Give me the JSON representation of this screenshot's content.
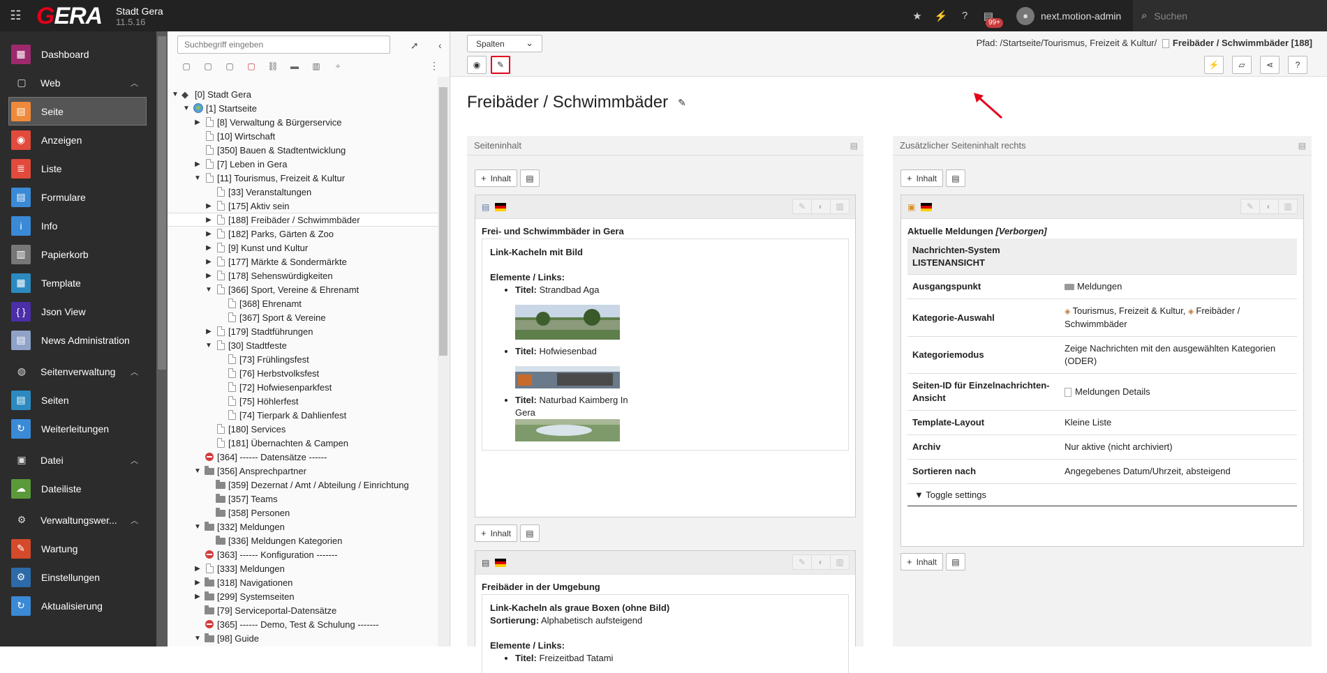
{
  "topbar": {
    "site_name": "Stadt Gera",
    "version": "11.5.16",
    "logo_text_a": "G",
    "logo_text_b": "ERA",
    "notifications_badge": "99+",
    "username": "next.motion-admin",
    "search_placeholder": "Suchen"
  },
  "sidebar": {
    "items": [
      {
        "type": "item",
        "label": "Dashboard",
        "icon": "dashboard-icon",
        "color": "#9e2a6d",
        "glyph": "▦"
      },
      {
        "type": "group",
        "label": "Web",
        "icon": "web-icon",
        "glyph": "▢"
      },
      {
        "type": "item",
        "label": "Seite",
        "icon": "page-module-icon",
        "color": "#f08a3a",
        "glyph": "▤",
        "active": true
      },
      {
        "type": "item",
        "label": "Anzeigen",
        "icon": "view-icon",
        "color": "#e24a3b",
        "glyph": "◉"
      },
      {
        "type": "item",
        "label": "Liste",
        "icon": "list-icon",
        "color": "#e24a3b",
        "glyph": "≣"
      },
      {
        "type": "item",
        "label": "Formulare",
        "icon": "forms-icon",
        "color": "#3a8ad6",
        "glyph": "▤"
      },
      {
        "type": "item",
        "label": "Info",
        "icon": "info-icon",
        "color": "#3a8ad6",
        "glyph": "i"
      },
      {
        "type": "item",
        "label": "Papierkorb",
        "icon": "trash-icon",
        "color": "#777",
        "glyph": "▥"
      },
      {
        "type": "item",
        "label": "Template",
        "icon": "template-icon",
        "color": "#2c8ac0",
        "glyph": "▦"
      },
      {
        "type": "item",
        "label": "Json View",
        "icon": "json-view-icon",
        "color": "#4b2ea8",
        "glyph": "{ }"
      },
      {
        "type": "item",
        "label": "News Administration",
        "icon": "news-icon",
        "color": "#8fa2c8",
        "glyph": "▤"
      },
      {
        "type": "group",
        "label": "Seitenverwaltung",
        "icon": "globe-icon",
        "glyph": "◍"
      },
      {
        "type": "item",
        "label": "Seiten",
        "icon": "pages-icon",
        "color": "#2c8ac0",
        "glyph": "▤"
      },
      {
        "type": "item",
        "label": "Weiterleitungen",
        "icon": "redirect-icon",
        "color": "#3a8ad6",
        "glyph": "↻"
      },
      {
        "type": "group",
        "label": "Datei",
        "icon": "file-icon",
        "glyph": "▣"
      },
      {
        "type": "item",
        "label": "Dateiliste",
        "icon": "filelist-icon",
        "color": "#5a9a3a",
        "glyph": "☁"
      },
      {
        "type": "group",
        "label": "Verwaltungswer...",
        "icon": "admin-tools-icon",
        "glyph": "⚙"
      },
      {
        "type": "item",
        "label": "Wartung",
        "icon": "maintenance-icon",
        "color": "#d44a2a",
        "glyph": "✎"
      },
      {
        "type": "item",
        "label": "Einstellungen",
        "icon": "settings-icon",
        "color": "#2c6aa8",
        "glyph": "⚙"
      },
      {
        "type": "item",
        "label": "Aktualisierung",
        "icon": "upgrade-icon",
        "color": "#3a8ad6",
        "glyph": "↻"
      }
    ]
  },
  "tree": {
    "search_placeholder": "Suchbegriff eingeben",
    "nodes": [
      {
        "label": "[0] Stadt Gera",
        "level": 0,
        "toggle": "open",
        "icon": "root"
      },
      {
        "label": "[1] Startseite",
        "level": 1,
        "toggle": "open",
        "icon": "globe"
      },
      {
        "label": "[8] Verwaltung & Bürgerservice",
        "level": 2,
        "toggle": "closed",
        "icon": "page"
      },
      {
        "label": "[10] Wirtschaft",
        "level": 2,
        "toggle": "",
        "icon": "page"
      },
      {
        "label": "[350] Bauen & Stadtentwicklung",
        "level": 2,
        "toggle": "",
        "icon": "page"
      },
      {
        "label": "[7] Leben in Gera",
        "level": 2,
        "toggle": "closed",
        "icon": "page"
      },
      {
        "label": "[11] Tourismus, Freizeit & Kultur",
        "level": 2,
        "toggle": "open",
        "icon": "page"
      },
      {
        "label": "[33] Veranstaltungen",
        "level": 3,
        "toggle": "",
        "icon": "page"
      },
      {
        "label": "[175] Aktiv sein",
        "level": 3,
        "toggle": "closed",
        "icon": "page"
      },
      {
        "label": "[188] Freibäder / Schwimmbäder",
        "level": 3,
        "toggle": "closed",
        "icon": "page",
        "selected": true
      },
      {
        "label": "[182] Parks, Gärten & Zoo",
        "level": 3,
        "toggle": "closed",
        "icon": "page"
      },
      {
        "label": "[9] Kunst und Kultur",
        "level": 3,
        "toggle": "closed",
        "icon": "page"
      },
      {
        "label": "[177] Märkte & Sondermärkte",
        "level": 3,
        "toggle": "closed",
        "icon": "page"
      },
      {
        "label": "[178] Sehenswürdigkeiten",
        "level": 3,
        "toggle": "closed",
        "icon": "page"
      },
      {
        "label": "[366] Sport, Vereine & Ehrenamt",
        "level": 3,
        "toggle": "open",
        "icon": "page"
      },
      {
        "label": "[368] Ehrenamt",
        "level": 4,
        "toggle": "",
        "icon": "page"
      },
      {
        "label": "[367] Sport & Vereine",
        "level": 4,
        "toggle": "",
        "icon": "page"
      },
      {
        "label": "[179] Stadtführungen",
        "level": 3,
        "toggle": "closed",
        "icon": "page"
      },
      {
        "label": "[30] Stadtfeste",
        "level": 3,
        "toggle": "open",
        "icon": "page"
      },
      {
        "label": "[73] Frühlingsfest",
        "level": 4,
        "toggle": "",
        "icon": "page"
      },
      {
        "label": "[76] Herbstvolksfest",
        "level": 4,
        "toggle": "",
        "icon": "page"
      },
      {
        "label": "[72] Hofwiesenparkfest",
        "level": 4,
        "toggle": "",
        "icon": "page"
      },
      {
        "label": "[75] Höhlerfest",
        "level": 4,
        "toggle": "",
        "icon": "page"
      },
      {
        "label": "[74] Tierpark & Dahlienfest",
        "level": 4,
        "toggle": "",
        "icon": "page"
      },
      {
        "label": "[180] Services",
        "level": 3,
        "toggle": "",
        "icon": "page"
      },
      {
        "label": "[181] Übernachten & Campen",
        "level": 3,
        "toggle": "",
        "icon": "page"
      },
      {
        "label": "[364] ------ Datensätze ------",
        "level": 2,
        "toggle": "",
        "icon": "stop"
      },
      {
        "label": "[356] Ansprechpartner",
        "level": 2,
        "toggle": "open",
        "icon": "folder"
      },
      {
        "label": "[359] Dezernat / Amt / Abteilung / Einrichtung",
        "level": 3,
        "toggle": "",
        "icon": "folder"
      },
      {
        "label": "[357] Teams",
        "level": 3,
        "toggle": "",
        "icon": "folder"
      },
      {
        "label": "[358] Personen",
        "level": 3,
        "toggle": "",
        "icon": "folder"
      },
      {
        "label": "[332] Meldungen",
        "level": 2,
        "toggle": "open",
        "icon": "folder"
      },
      {
        "label": "[336] Meldungen Kategorien",
        "level": 3,
        "toggle": "",
        "icon": "folder"
      },
      {
        "label": "[363] ------ Konfiguration -------",
        "level": 2,
        "toggle": "",
        "icon": "stop"
      },
      {
        "label": "[333] Meldungen",
        "level": 2,
        "toggle": "closed",
        "icon": "page"
      },
      {
        "label": "[318] Navigationen",
        "level": 2,
        "toggle": "closed",
        "icon": "folder"
      },
      {
        "label": "[299] Systemseiten",
        "level": 2,
        "toggle": "closed",
        "icon": "folder"
      },
      {
        "label": "[79] Serviceportal-Datensätze",
        "level": 2,
        "toggle": "",
        "icon": "folder"
      },
      {
        "label": "[365] ------ Demo, Test & Schulung -------",
        "level": 2,
        "toggle": "",
        "icon": "stop"
      },
      {
        "label": "[98] Guide",
        "level": 2,
        "toggle": "open",
        "icon": "folder"
      }
    ]
  },
  "docheader": {
    "columns_select": "Spalten",
    "path_prefix": "Pfad: /Startseite/Tourismus, Freizeit & Kultur/",
    "path_current": "Freibäder / Schwimmbäder [188]"
  },
  "page": {
    "title": "Freibäder / Schwimmbäder",
    "col_left_title": "Seiteninhalt",
    "col_right_title": "Zusätzlicher Seiteninhalt rechts",
    "add_content_label": "Inhalt"
  },
  "left_elements": [
    {
      "header": "Frei- und Schwimmbäder in Gera",
      "type_label": "Link-Kacheln mit Bild",
      "list_title": "Elemente / Links:",
      "items": [
        {
          "key": "Titel:",
          "value": "Strandbad Aga"
        },
        {
          "key": "Titel:",
          "value": "Hofwiesenbad"
        },
        {
          "key": "Titel:",
          "value": "Naturbad Kaimberg In Gera"
        }
      ]
    },
    {
      "header": "Freibäder in der Umgebung",
      "type_label": "Link-Kacheln als graue Boxen (ohne Bild)",
      "sort_key": "Sortierung:",
      "sort_value": "Alphabetisch aufsteigend",
      "list_title": "Elemente / Links:",
      "items": [
        {
          "key": "Titel:",
          "value": "Freizeitbad Tatami"
        }
      ]
    }
  ],
  "right_element": {
    "header": "Aktuelle Meldungen",
    "hidden_label": "[Verborgen]",
    "plugin_title_line1": "Nachrichten-System",
    "plugin_title_line2": "LISTENANSICHT",
    "rows": [
      {
        "key": "Ausgangspunkt",
        "value": "Meldungen"
      },
      {
        "key": "Kategorie-Auswahl",
        "value": "Tourismus, Freizeit & Kultur,",
        "value2": "Freibäder / Schwimmbäder"
      },
      {
        "key": "Kategoriemodus",
        "value": "Zeige Nachrichten mit den ausgewählten Kategorien (ODER)"
      },
      {
        "key": "Seiten-ID für Einzelnachrichten-Ansicht",
        "value": "Meldungen Details"
      },
      {
        "key": "Template-Layout",
        "value": "Kleine Liste"
      },
      {
        "key": "Archiv",
        "value": "Nur aktive (nicht archiviert)"
      },
      {
        "key": "Sortieren nach",
        "value": "Angegebenes Datum/Uhrzeit, absteigend"
      }
    ],
    "toggle_label": "Toggle settings"
  },
  "colors": {
    "topbar": "#222222",
    "sidebar": "#2c2c2c",
    "highlight": "#e3001b"
  }
}
